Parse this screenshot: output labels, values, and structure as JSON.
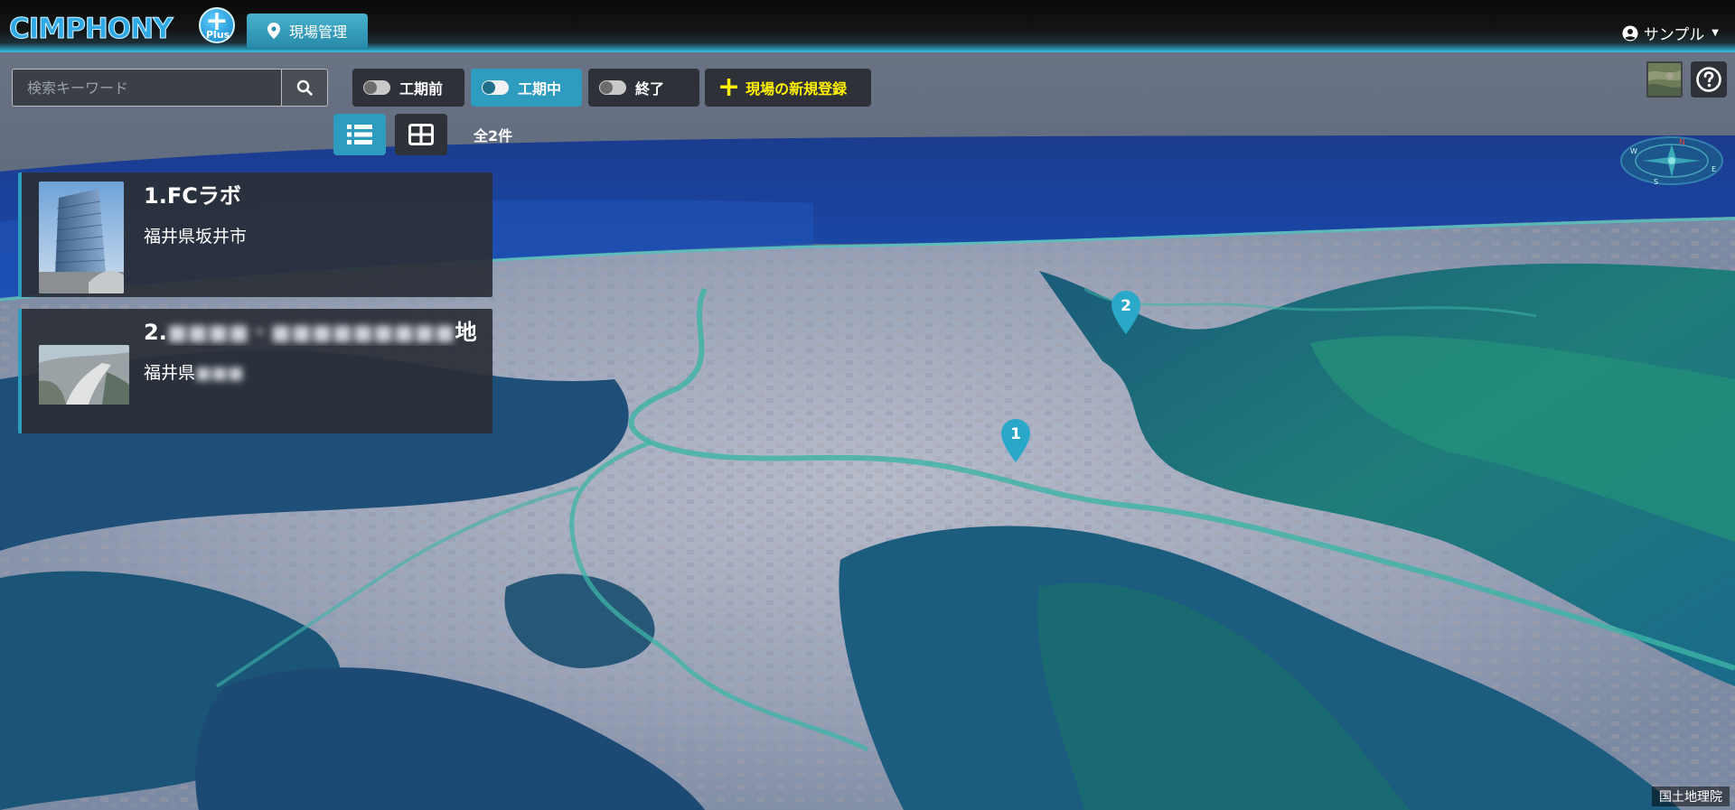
{
  "app": {
    "logo_text": "CIMPHONY",
    "logo_plus_sign": "+",
    "logo_plus_sub": "Plus"
  },
  "nav": {
    "tab_label": "現場管理"
  },
  "user": {
    "name": "サンプル"
  },
  "search": {
    "placeholder": "検索キーワード",
    "value": ""
  },
  "filters": [
    {
      "label": "工期前",
      "active": false
    },
    {
      "label": "工期中",
      "active": true
    },
    {
      "label": "終了",
      "active": false
    }
  ],
  "new_site_label": "現場の新規登録",
  "result_count": "全2件",
  "sites": [
    {
      "title": "1.FCラボ",
      "address": "福井県坂井市"
    },
    {
      "title": "2.",
      "title_obscured": "■■■■・■■■■■■■■■",
      "title_tail": "地…",
      "address": "福井県",
      "address_obscured": "■■■"
    }
  ],
  "markers": [
    {
      "label": "1"
    },
    {
      "label": "2"
    }
  ],
  "compass_letters": [
    "W",
    "N",
    "E",
    "S"
  ],
  "attribution": "国土地理院",
  "colors": {
    "accent": "#2e9cbf",
    "new_button_text": "#fff200",
    "panel": "#2e3138"
  },
  "icons": {
    "nav_tab": "map-pin-icon",
    "user": "user-circle-icon",
    "search": "search-icon",
    "list_view": "list-icon",
    "grid_view": "grid-icon",
    "help": "question-circle-icon",
    "layer": "map-layer-thumbnail-icon",
    "compass": "compass-icon"
  }
}
